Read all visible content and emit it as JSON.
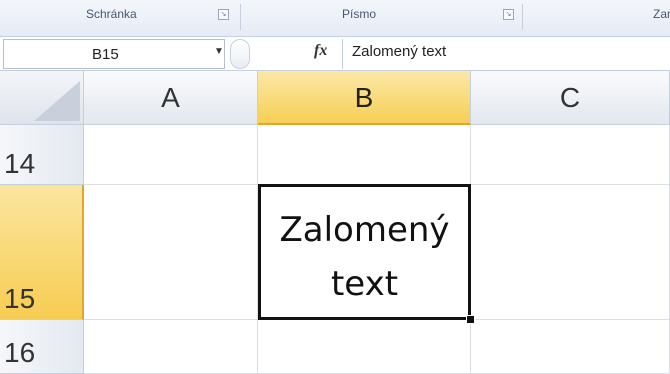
{
  "ribbon": {
    "groups": [
      "Schránka",
      "Písmo",
      "Zar"
    ]
  },
  "formula_bar": {
    "name_box": "B15",
    "fx_label": "fx",
    "value": "Zalomený text"
  },
  "grid": {
    "columns": [
      "A",
      "B",
      "C"
    ],
    "rows": [
      "14",
      "15",
      "16"
    ],
    "selected_column": "B",
    "selected_row": "15",
    "active_cell": {
      "ref": "B15",
      "line1": "Zalomený",
      "line2": "text"
    }
  },
  "colors": {
    "selection_header": "#f7cf55",
    "header_bg": "#e3e8ef",
    "gridline": "#dadfe6"
  }
}
